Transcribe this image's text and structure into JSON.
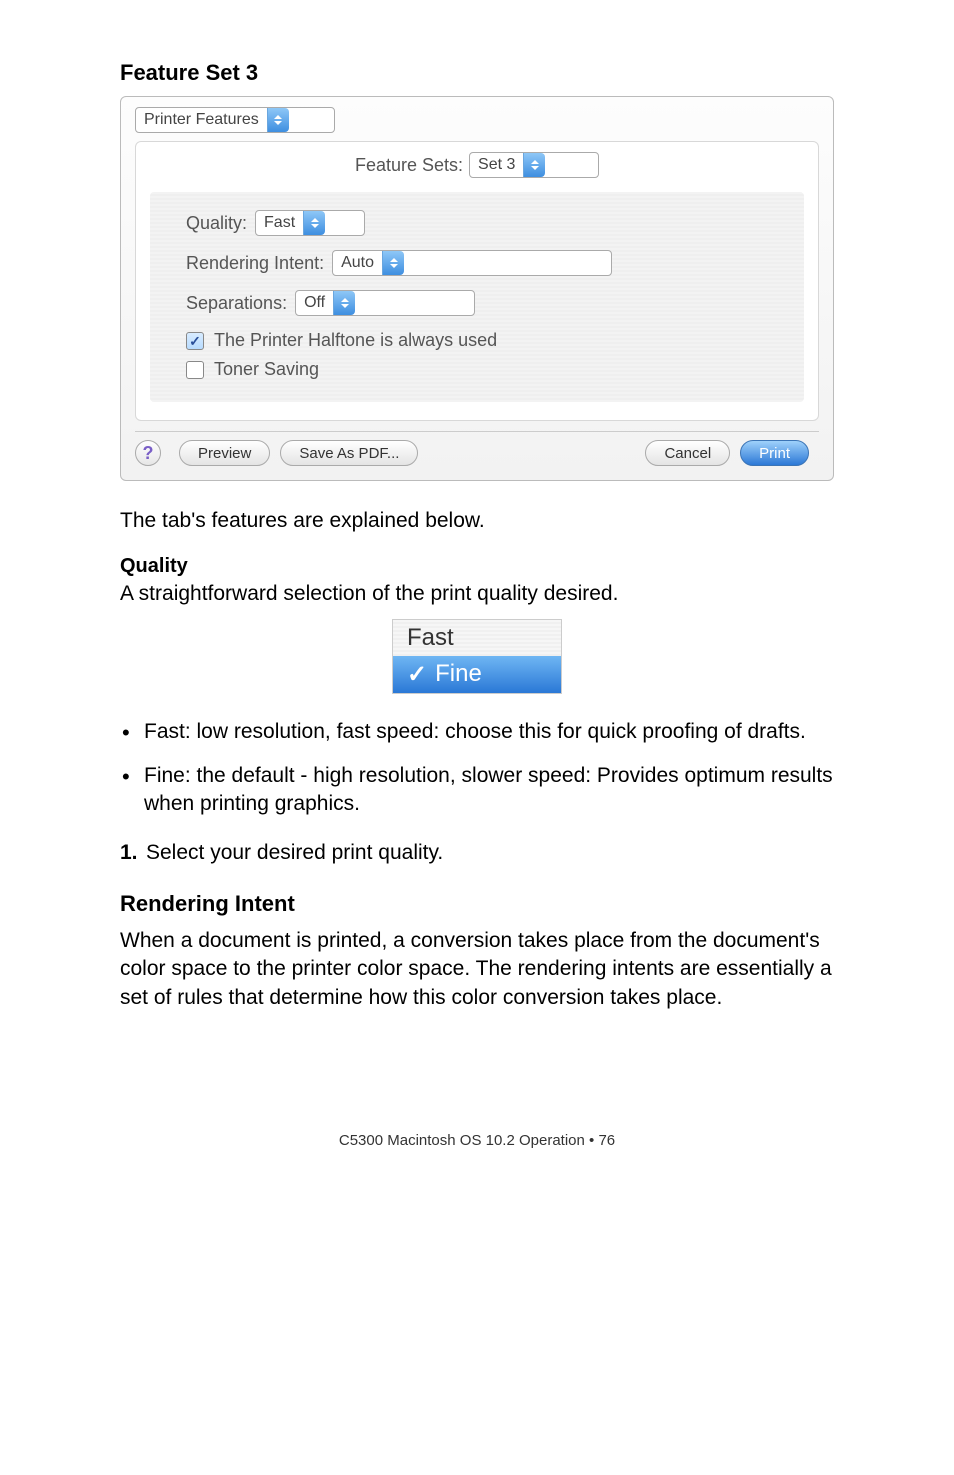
{
  "heading_set3": "Feature Set 3",
  "dialog": {
    "main_select": "Printer Features",
    "feature_sets_label": "Feature Sets:",
    "feature_sets_value": "Set 3",
    "quality_label": "Quality:",
    "quality_value": "Fast",
    "rendering_label": "Rendering Intent:",
    "rendering_value": "Auto",
    "separations_label": "Separations:",
    "separations_value": "Off",
    "cb_halftone": "The Printer Halftone is always used",
    "cb_toner": "Toner Saving",
    "btn_preview": "Preview",
    "btn_savepdf": "Save As PDF...",
    "btn_cancel": "Cancel",
    "btn_print": "Print"
  },
  "explain_text": "The tab's features are explained below.",
  "quality": {
    "title": "Quality",
    "desc": "A straightforward selection of the print quality desired.",
    "opt_fast": "Fast",
    "opt_fine": "Fine"
  },
  "bullets": {
    "fast": "Fast: low resolution, fast speed: choose this for quick proofing of drafts.",
    "fine": "Fine: the default - high resolution, slower speed: Provides optimum results when printing graphics."
  },
  "step1_num": "1.",
  "step1_text": "Select your desired print quality.",
  "rendering_heading": "Rendering Intent",
  "rendering_para": "When a document is printed, a conversion takes place from the document's color space to the printer color space. The rendering intents are essentially a set of rules that determine how this color conversion takes place.",
  "footer": "C5300 Macintosh OS 10.2 Operation  •  76"
}
